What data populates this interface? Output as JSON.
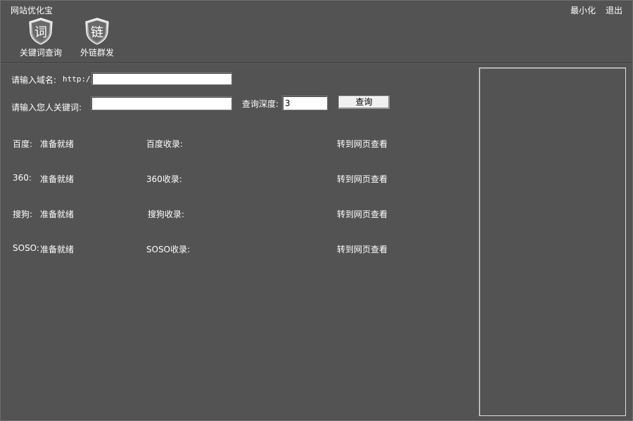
{
  "app": {
    "title": "网站优化宝"
  },
  "window_controls": {
    "minimize": "最小化",
    "exit": "退出"
  },
  "toolbar": [
    {
      "icon_char": "词",
      "label": "关键词查询"
    },
    {
      "icon_char": "链",
      "label": "外链群发"
    }
  ],
  "form": {
    "domain_label": "请输入域名:",
    "domain_prefix": "http://",
    "domain_value": "",
    "keyword_label": "请输入您人关键词:",
    "keyword_value": "",
    "depth_label": "查询深度:",
    "depth_value": "3",
    "query_button": "查询"
  },
  "results": [
    {
      "engine_label": "百度:",
      "status": "准备就绪",
      "index_label": "百度收录:",
      "link": "转到网页查看"
    },
    {
      "engine_label": "360:",
      "status": "准备就绪",
      "index_label": "360收录:",
      "link": "转到网页查看"
    },
    {
      "engine_label": "搜狗:",
      "status": "准备就绪",
      "index_label": "搜狗收录:",
      "link": "转到网页查看"
    },
    {
      "engine_label": "SOSO:",
      "status": "准备就绪",
      "index_label": "SOSO收录:",
      "link": "转到网页查看"
    }
  ]
}
